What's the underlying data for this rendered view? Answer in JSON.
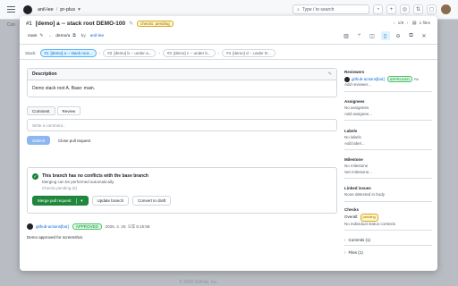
{
  "topbar": {
    "owner": "anil-lee",
    "repo": "pr-plus",
    "search_placeholder": "Type / to search",
    "add_icon": "+",
    "caret_icon": "▾"
  },
  "background": {
    "crumb_left": "Con",
    "footer": "© 2026 GitHub, Inc."
  },
  "modal": {
    "pr_number": "#1",
    "title": "[demo] a -- stack root DEMO-100",
    "status_badge": "checks: pending",
    "base_branch": "main",
    "head_branch": "demo/a",
    "by_label": "by",
    "author": "anil-lee",
    "files_label": "1 files",
    "nav_label": "1/8",
    "stack": {
      "label": "Stack:",
      "items": [
        {
          "num": "#1",
          "label": "[demo] a -- stack root..."
        },
        {
          "num": "#2",
          "label": "[demo] b -- under a..."
        },
        {
          "num": "#3",
          "label": "[demo] c -- under b..."
        },
        {
          "num": "#4",
          "label": "[demo] d -- under D..."
        }
      ]
    },
    "description": {
      "heading": "Description",
      "body": "Demo stack root A. Base: main."
    },
    "compose": {
      "tab_comment": "Comment",
      "tab_review": "Review",
      "placeholder": "Write a comment...",
      "submit": "Submit",
      "close_pr": "Close pull request"
    },
    "merge": {
      "title": "This branch has no conflicts with the base branch",
      "subtitle": "Merging can be performed automatically.",
      "checks": "Checks pending (0)",
      "merge_button": "Merge pull request",
      "update_branch": "Update branch",
      "convert_draft": "Convert to draft"
    },
    "review": {
      "reviewer": "github-actions[bot]",
      "state": "APPROVED",
      "timestamp": "2026. 2. 25. 오후 6:15:58",
      "body": "Demo approved for screenshot."
    },
    "sidebar": {
      "reviewers": {
        "heading": "Reviewers",
        "name": "github-actions[bot]",
        "state": "APPROVED",
        "rerequest": "Re",
        "add": "Add reviewer..."
      },
      "assignees": {
        "heading": "Assignees",
        "value": "No assignees",
        "add": "Add assignee..."
      },
      "labels": {
        "heading": "Labels",
        "value": "No labels",
        "add": "Add label..."
      },
      "milestone": {
        "heading": "Milestone",
        "value": "No milestone",
        "add": "Set milestone..."
      },
      "linked_issues": {
        "heading": "Linked issues",
        "value": "None detected in body"
      },
      "checks": {
        "heading": "Checks",
        "overall_label": "Overall:",
        "overall_state": "pending",
        "value": "No individual status contexts"
      },
      "commits": "Commits (1)",
      "files": "Files (1)"
    }
  }
}
